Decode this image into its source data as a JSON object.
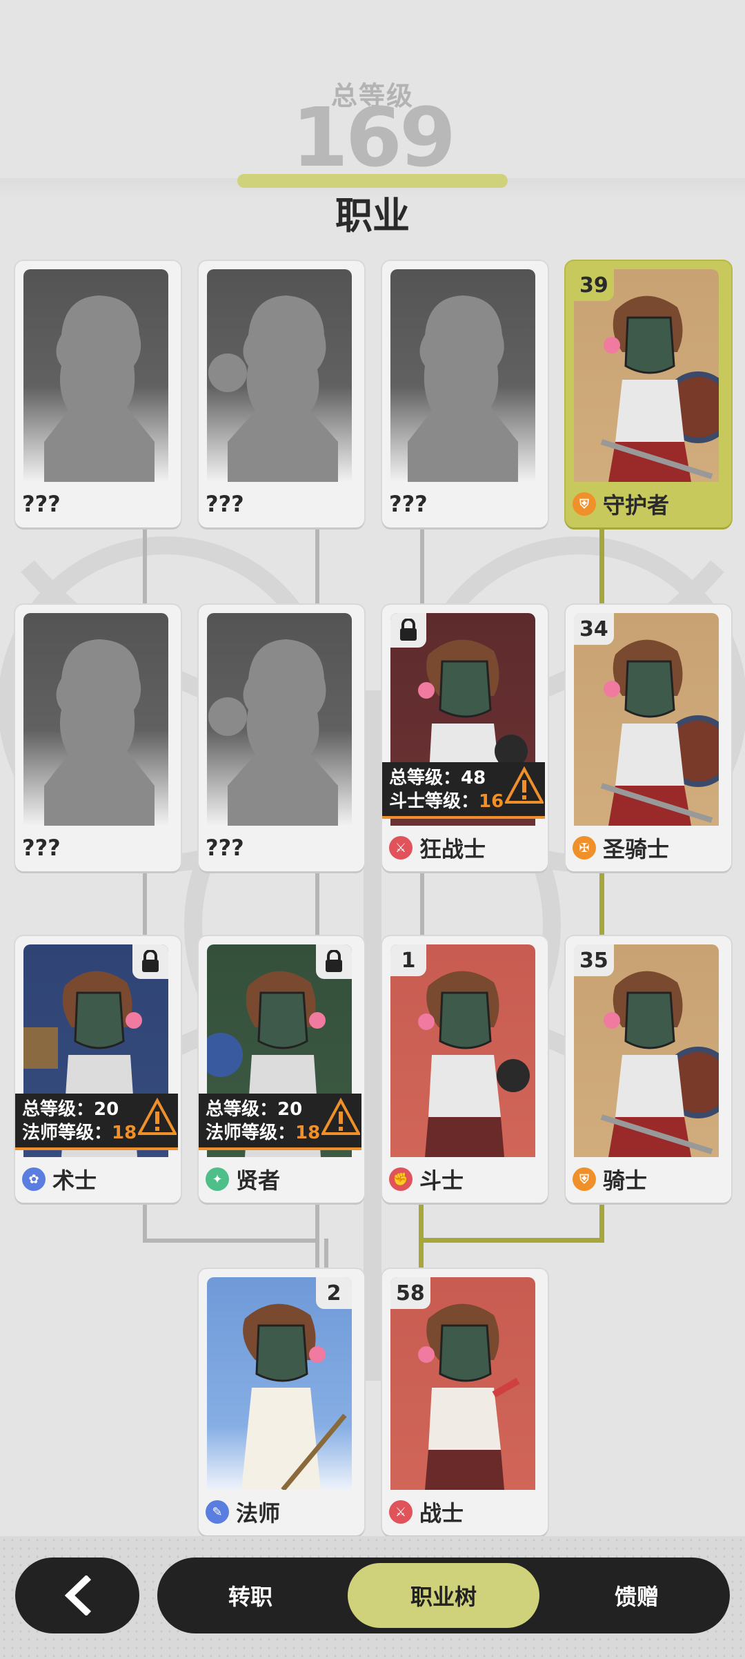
{
  "header": {
    "total_label": "总等级",
    "total_value": "169",
    "page_title": "职业"
  },
  "colors": {
    "accent": "#cfd27a",
    "connector_active": "#a7a63a",
    "connector_inactive": "#b5b5b5",
    "warning": "#f0902a"
  },
  "cards": {
    "r1c1": {
      "name": "???"
    },
    "r1c2": {
      "name": "???"
    },
    "r1c3": {
      "name": "???"
    },
    "r1c4": {
      "name": "守护者",
      "level": "39",
      "icon": "guardian-class-icon",
      "icon_color": "#f0902a"
    },
    "r2c1": {
      "name": "???"
    },
    "r2c2": {
      "name": "???"
    },
    "r2c3": {
      "name": "狂战士",
      "icon": "berserker-class-icon",
      "icon_color": "#e0535a",
      "req_total": "总等级：48",
      "req_sub_label": "斗士等级：",
      "req_sub_value": "16"
    },
    "r2c4": {
      "name": "圣骑士",
      "level": "34",
      "icon": "paladin-class-icon",
      "icon_color": "#f0902a"
    },
    "r3c1": {
      "name": "术士",
      "icon": "warlock-class-icon",
      "icon_color": "#5a7ee0",
      "req_total": "总等级：20",
      "req_sub_label": "法师等级：",
      "req_sub_value": "18"
    },
    "r3c2": {
      "name": "贤者",
      "icon": "sage-class-icon",
      "icon_color": "#4fbf8a",
      "req_total": "总等级：20",
      "req_sub_label": "法师等级：",
      "req_sub_value": "18"
    },
    "r3c3": {
      "name": "斗士",
      "level": "1",
      "icon": "fighter-class-icon",
      "icon_color": "#e0535a"
    },
    "r3c4": {
      "name": "骑士",
      "level": "35",
      "icon": "knight-class-icon",
      "icon_color": "#f0902a"
    },
    "r4c2": {
      "name": "法师",
      "level": "2",
      "icon": "mage-class-icon",
      "icon_color": "#5a7ee0"
    },
    "r4c3": {
      "name": "战士",
      "level": "58",
      "icon": "warrior-class-icon",
      "icon_color": "#e0535a"
    }
  },
  "nav": {
    "tabs": [
      "转职",
      "职业树",
      "馈赠"
    ],
    "active_tab": "职业树"
  }
}
